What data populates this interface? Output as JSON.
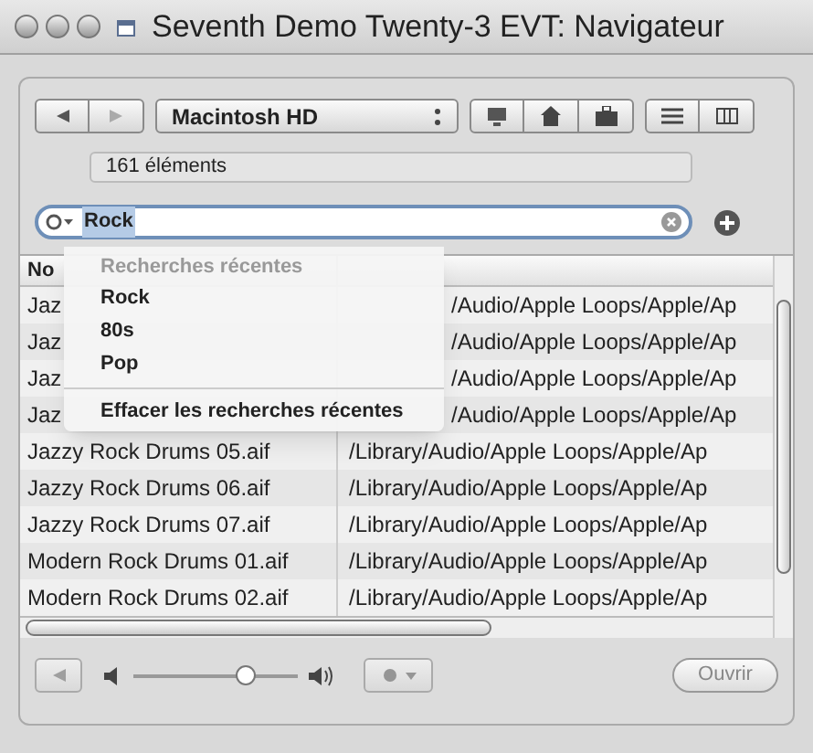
{
  "window": {
    "title": "Seventh Demo Twenty-3 EVT: Navigateur"
  },
  "location": {
    "value": "Macintosh HD"
  },
  "item_count": "161 éléments",
  "search": {
    "value": "Rock"
  },
  "recent_menu": {
    "heading": "Recherches récentes",
    "items": [
      "Rock",
      "80s",
      "Pop"
    ],
    "clear": "Effacer les recherches récentes"
  },
  "table": {
    "columns": [
      "No"
    ],
    "rows": [
      {
        "name": "Jaz",
        "path": "/Audio/Apple Loops/Apple/Ap",
        "covered": true
      },
      {
        "name": "Jaz",
        "path": "/Audio/Apple Loops/Apple/Ap",
        "covered": true
      },
      {
        "name": "Jaz",
        "path": "/Audio/Apple Loops/Apple/Ap",
        "covered": true
      },
      {
        "name": "Jaz",
        "path": "/Audio/Apple Loops/Apple/Ap",
        "covered": true
      },
      {
        "name": "Jazzy Rock Drums 05.aif",
        "path": "/Library/Audio/Apple Loops/Apple/Ap",
        "covered": false
      },
      {
        "name": "Jazzy Rock Drums 06.aif",
        "path": "/Library/Audio/Apple Loops/Apple/Ap",
        "covered": false
      },
      {
        "name": "Jazzy Rock Drums 07.aif",
        "path": "/Library/Audio/Apple Loops/Apple/Ap",
        "covered": false
      },
      {
        "name": "Modern Rock Drums 01.aif",
        "path": "/Library/Audio/Apple Loops/Apple/Ap",
        "covered": false
      },
      {
        "name": "Modern Rock Drums 02.aif",
        "path": "/Library/Audio/Apple Loops/Apple/Ap",
        "covered": false
      }
    ]
  },
  "volume": {
    "level": 0.68
  },
  "open_button": "Ouvrir"
}
